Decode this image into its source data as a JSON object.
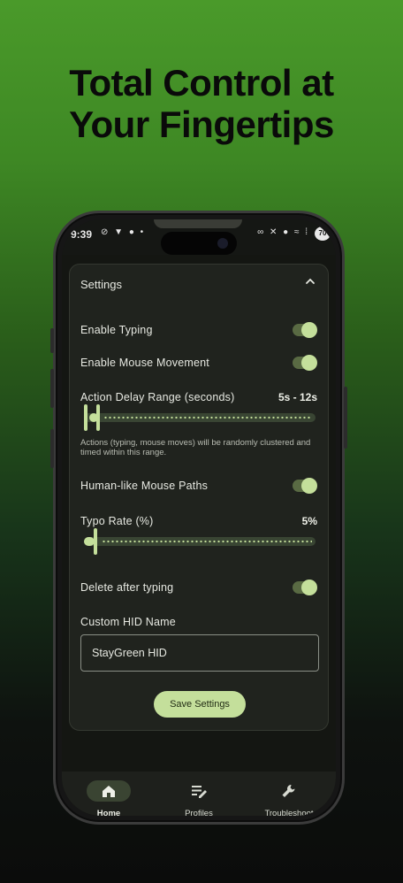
{
  "headline": {
    "line1": "Total Control at",
    "line2": "Your Fingertips"
  },
  "statusbar": {
    "time": "9:39",
    "left_icons": "⊘ ▼ ● •",
    "right_icons": "∞ ✕ ● ≈ ⁞",
    "battery": "70"
  },
  "settings": {
    "title": "Settings",
    "enable_typing": {
      "label": "Enable Typing",
      "on": true
    },
    "enable_mouse": {
      "label": "Enable Mouse Movement",
      "on": true
    },
    "delay": {
      "label": "Action Delay Range (seconds)",
      "value": "5s - 12s",
      "helper": "Actions (typing, mouse moves) will be randomly clustered and timed within this range."
    },
    "human_paths": {
      "label": "Human-like Mouse Paths",
      "on": true
    },
    "typo": {
      "label": "Typo Rate (%)",
      "value": "5%"
    },
    "delete_after": {
      "label": "Delete after typing",
      "on": true
    },
    "hid_name": {
      "label": "Custom HID Name",
      "value": "StayGreen HID"
    },
    "save_label": "Save Settings"
  },
  "nav": {
    "items": [
      {
        "label": "Home",
        "icon": "home-icon",
        "active": true
      },
      {
        "label": "Profiles",
        "icon": "edit-list-icon",
        "active": false
      },
      {
        "label": "Troubleshoot",
        "icon": "wrench-icon",
        "active": false
      }
    ]
  },
  "colors": {
    "accent": "#c4df9b",
    "card": "#20231e",
    "background": "#141612"
  }
}
